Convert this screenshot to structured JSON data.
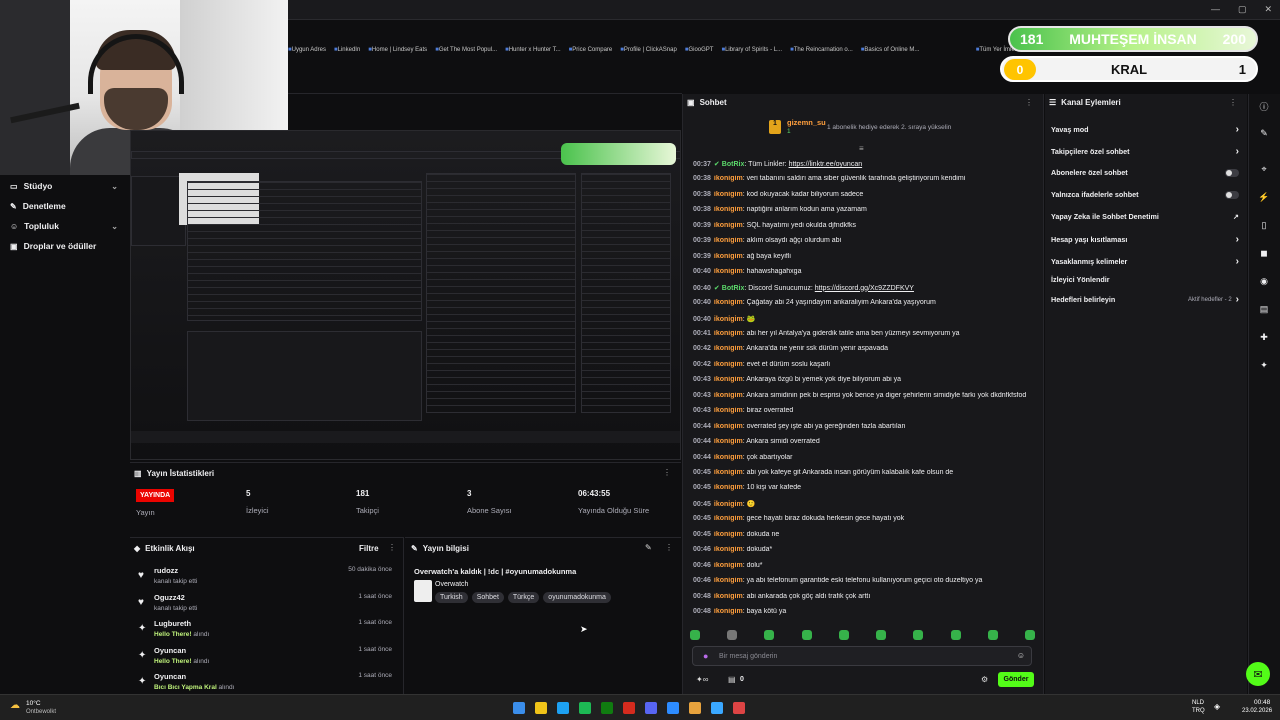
{
  "browser": {
    "bookmarks": [
      "Uygun Adres",
      "LinkedIn",
      "Home | Lindsey Eats",
      "Get The Most Popul...",
      "Hunter x Hunter T...",
      "Price Compare",
      "Profile | ClickASnap",
      "GiooGPT",
      "Library of Spirits - L...",
      "The Reincarnation o...",
      "Basics of Online M..."
    ],
    "extra": "Tüm Yer İmleri"
  },
  "overlay": {
    "row1_left": "181",
    "row1_title": "MUHTEŞEM İNSAN",
    "row1_right": "200",
    "row2_left": "0",
    "row2_title": "KRAL",
    "row2_right": "1"
  },
  "sidenav": [
    {
      "label": "Stüdyo",
      "icon": "monitor-icon",
      "chevron": "⌄"
    },
    {
      "label": "Denetleme",
      "icon": "sword-icon"
    },
    {
      "label": "Topluluk",
      "icon": "users-icon",
      "chevron": "⌄"
    },
    {
      "label": "Droplar ve ödüller",
      "icon": "gift-icon"
    }
  ],
  "stats": {
    "title": "Yayın İstatistikleri",
    "live_badge": "YAYINDA",
    "live_label": "Yayın",
    "items": [
      {
        "value": "5",
        "label": "İzleyici"
      },
      {
        "value": "181",
        "label": "Takipçi"
      },
      {
        "value": "3",
        "label": "Abone Sayısı"
      },
      {
        "value": "06:43:55",
        "label": "Yayında Olduğu Süre"
      }
    ]
  },
  "events": {
    "title": "Etkinlik Akışı",
    "filter": "Filtre",
    "items": [
      {
        "icon": "heart-icon",
        "name": "rudozz",
        "sub": "kanalı takip etti",
        "reward": "",
        "time": "50 dakika önce"
      },
      {
        "icon": "heart-icon",
        "name": "Oguzz42",
        "sub": "kanalı takip etti",
        "reward": "",
        "time": "1 saat önce"
      },
      {
        "icon": "points-icon",
        "name": "Lugbureth",
        "sub": " alındı",
        "reward": "Hello There!",
        "time": "1 saat önce"
      },
      {
        "icon": "points-icon",
        "name": "Oyuncan",
        "sub": " alındı",
        "reward": "Hello There!",
        "time": "1 saat önce"
      },
      {
        "icon": "points-icon",
        "name": "Oyuncan",
        "sub": " alındı",
        "reward": "Bıcı Bıcı Yapma Kral",
        "time": "1 saat önce"
      }
    ]
  },
  "info": {
    "title": "Yayın bilgisi",
    "stream_title": "Overwatch'a kaldık | !dc | #oyunumadokunma",
    "game": "Overwatch",
    "tags": [
      "Turkish",
      "Sohbet",
      "Türkçe",
      "oyunumadokunma"
    ]
  },
  "chat": {
    "title": "Sohbet",
    "gift_user": "gizemn_su",
    "gift_count": "1",
    "gift_text": "1 abonelik hediye ederek 2. sıraya yükselin",
    "messages": [
      {
        "t": "00:37",
        "u": "BotRix",
        "bot": true,
        "m": ": Tüm Linkler: ",
        "link": "https://linktr.ee/oyuncan"
      },
      {
        "t": "00:38",
        "u": "ikonigim",
        "m": ": veri tabanını saldırı ama siber güvenlik tarafında geliştiriyorum kendimi"
      },
      {
        "t": "00:38",
        "u": "ikonigim",
        "m": ": kod okuyacak kadar biliyorum sadece"
      },
      {
        "t": "00:38",
        "u": "ikonigim",
        "m": ": naptiğini anlarım kodun ama yazamam"
      },
      {
        "t": "00:39",
        "u": "ikonigim",
        "m": ": SQL hayatımı yedi okulda djfndkfks"
      },
      {
        "t": "00:39",
        "u": "ikonigim",
        "m": ": aklım olsaydı ağçı olurdum abi"
      },
      {
        "t": "00:39",
        "u": "ikonigim",
        "m": ": ağ baya keyifli"
      },
      {
        "t": "00:40",
        "u": "ikonigim",
        "m": ": hahawshagahxga"
      },
      {
        "t": "00:40",
        "u": "BotRix",
        "bot": true,
        "m": ": Discord Sunucumuz: ",
        "link": "https://discord.gg/Xc9ZZDFKVY"
      },
      {
        "t": "00:40",
        "u": "ikonigim",
        "m": ": Çağatay abi 24 yaşındayım ankaraliyim Ankara'da yaşıyorum"
      },
      {
        "t": "00:40",
        "u": "ikonigim",
        "m": ": 🐸"
      },
      {
        "t": "00:41",
        "u": "ikonigim",
        "m": ": abi her yıl Antalya'ya giderdik tatile ama ben yüzmeyi sevmiyorum ya"
      },
      {
        "t": "00:42",
        "u": "ikonigim",
        "m": ": Ankara'da ne yenir ssk dürüm yenir aspavada"
      },
      {
        "t": "00:42",
        "u": "ikonigim",
        "m": ": evet et dürüm soslu kaşarlı"
      },
      {
        "t": "00:43",
        "u": "ikonigim",
        "m": ": Ankaraya özgü bi yemek yok diye biliyorum abi ya"
      },
      {
        "t": "00:43",
        "u": "ikonigim",
        "m": ": Ankara simidinin pek bi esprisi yok bence ya diger şehirlerin simidiyle farkı yok dkdnfkfsfod"
      },
      {
        "t": "00:43",
        "u": "ikonigim",
        "m": ": biraz overrated"
      },
      {
        "t": "00:44",
        "u": "ikonigim",
        "m": ": overrated şey işte abi ya gereğinden fazla abartılan"
      },
      {
        "t": "00:44",
        "u": "ikonigim",
        "m": ": Ankara simidi overrated"
      },
      {
        "t": "00:44",
        "u": "ikonigim",
        "m": ": çok abartıyolar"
      },
      {
        "t": "00:45",
        "u": "ikonigim",
        "m": ": abi yok kafeye git Ankarada insan görüyüm kalabalık kafe olsun de"
      },
      {
        "t": "00:45",
        "u": "ikonigim",
        "m": ": 10 kişi var kafede"
      },
      {
        "t": "00:45",
        "u": "ikonigim",
        "m": ": 🙂"
      },
      {
        "t": "00:45",
        "u": "ikonigim",
        "m": ": gece hayatı biraz dokuda herkesin gece hayatı yok"
      },
      {
        "t": "00:45",
        "u": "ikonigim",
        "m": ": dokuda ne"
      },
      {
        "t": "00:46",
        "u": "ikonigim",
        "m": ": dokuda*"
      },
      {
        "t": "00:46",
        "u": "ikonigim",
        "m": ": dolu*"
      },
      {
        "t": "00:46",
        "u": "ikonigim",
        "m": ": ya abi telefonum garantide eski telefonu kullanıyorum geçici oto duzeltiyo ya"
      },
      {
        "t": "00:48",
        "u": "ikonigim",
        "m": ": abi ankarada çok göç aldı trafik çok arttı"
      },
      {
        "t": "00:48",
        "u": "ikonigim",
        "m": ": baya kötü ya"
      }
    ],
    "placeholder": "Bir mesaj gönderin",
    "points": "0",
    "send": "Gönder"
  },
  "actions": {
    "title": "Kanal Eylemleri",
    "items": [
      {
        "label": "Yavaş mod",
        "ctl": "chevron"
      },
      {
        "label": "Takipçilere özel sohbet",
        "ctl": "chevron"
      },
      {
        "label": "Abonelere özel sohbet",
        "ctl": "toggle"
      },
      {
        "label": "Yalnızca ifadelerle sohbet",
        "ctl": "toggle"
      },
      {
        "label": "Yapay Zeka ile Sohbet Denetimi",
        "ctl": "external"
      },
      {
        "label": "Hesap yaşı kısıtlaması",
        "ctl": "chevron"
      },
      {
        "label": "Yasaklanmış kelimeler",
        "ctl": "chevron"
      },
      {
        "label": "İzleyici Yönlendir",
        "ctl": ""
      },
      {
        "label": "Hedefleri belirleyin",
        "ctl": "chevron",
        "extra": "Aktif hedefler - 2"
      }
    ]
  },
  "taskbar": {
    "weather_temp": "10°C",
    "weather_text": "Ontbewolkt",
    "lang1": "NLD",
    "lang2": "TRQ",
    "time": "00:48",
    "date": "23.02.2026"
  }
}
